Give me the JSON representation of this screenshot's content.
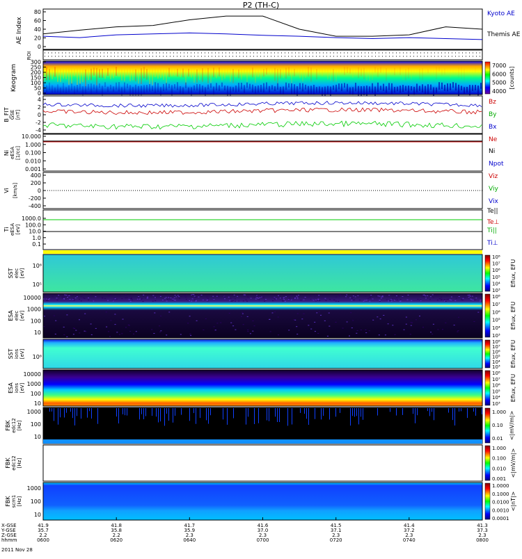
{
  "title": "P2 (TH-C)",
  "panels": {
    "ae": {
      "ylabel": "AE Index",
      "yticks": [
        "80",
        "60",
        "40",
        "20",
        "0"
      ],
      "legend": [
        {
          "text": "Kyoto AE",
          "color": "#0000cc"
        },
        {
          "text": "Themis AE",
          "color": "#000000"
        }
      ]
    },
    "roi": {
      "ylabel": "ROI"
    },
    "keo": {
      "ylabel": "Keogram",
      "yticks": [
        "300",
        "250",
        "200",
        "150",
        "100",
        "50",
        "0"
      ],
      "colorbar": [
        "7000",
        "6000",
        "5000",
        "4000"
      ],
      "colorbar_label": "[counts]"
    },
    "bfit": {
      "ylabel": "B_FIT",
      "ylabel2": "GSE",
      "ylabel3": "[nT]",
      "yticks": [
        "4",
        "2",
        "0",
        "-2",
        "-4"
      ],
      "legend": [
        {
          "text": "Bz",
          "color": "#cc0000"
        },
        {
          "text": "By",
          "color": "#00aa00"
        },
        {
          "text": "Bx",
          "color": "#0000cc"
        }
      ]
    },
    "ni": {
      "ylabel": "Ni",
      "ylabel2": "eESA",
      "ylabel3": "[1/cc]",
      "yticks": [
        "10.000",
        "1.000",
        "0.100",
        "0.010",
        "0.001"
      ],
      "legend": [
        {
          "text": "Ne",
          "color": "#cc0000"
        },
        {
          "text": "Ni",
          "color": "#000000"
        },
        {
          "text": "Npot",
          "color": "#0000cc"
        }
      ]
    },
    "vi": {
      "ylabel": "Vi",
      "ylabel3": "[km/s]",
      "yticks": [
        "400",
        "200",
        "0",
        "-200",
        "-400"
      ],
      "legend": [
        {
          "text": "Viz",
          "color": "#cc0000"
        },
        {
          "text": "Viy",
          "color": "#00aa00"
        },
        {
          "text": "Vix",
          "color": "#0000cc"
        }
      ]
    },
    "ti": {
      "ylabel": "Ti",
      "ylabel2": "eESA",
      "ylabel3": "[eV]",
      "yticks": [
        "1000.0",
        "100.0",
        "10.0",
        "1.0",
        "0.1"
      ],
      "legend": [
        {
          "text": "Te||",
          "color": "#000000"
        },
        {
          "text": "Te⊥",
          "color": "#cc0000"
        },
        {
          "text": "Ti||",
          "color": "#00aa00"
        },
        {
          "text": "Ti⊥",
          "color": "#0000cc"
        }
      ]
    },
    "sste": {
      "ylabel": "SST",
      "ylabel2": "elec",
      "ylabel3": "[eV]",
      "yticks": [
        "10⁶",
        "10⁵"
      ],
      "cbticks": [
        "10⁸",
        "10⁷",
        "10⁶",
        "10⁵",
        "10⁴",
        "10³"
      ],
      "cblabel": "Eflux, EFU"
    },
    "esae": {
      "ylabel": "ESA",
      "ylabel2": "elec",
      "ylabel3": "[eV]",
      "yticks": [
        "10000",
        "1000",
        "100",
        "10"
      ],
      "cbticks": [
        "10⁸",
        "10⁷",
        "10⁶",
        "10⁵",
        "10⁴",
        "10³"
      ],
      "cblabel": "Eflux, EFU"
    },
    "ssti": {
      "ylabel": "SST",
      "ylabel2": "ions",
      "ylabel3": "[eV]",
      "yticks": [
        "10⁶"
      ],
      "cbticks": [
        "10⁸",
        "10⁷",
        "10⁶",
        "10⁵",
        "10⁴",
        "10³"
      ],
      "cblabel": "Eflux, EFU"
    },
    "esai": {
      "ylabel": "ESA",
      "ylabel2": "ions",
      "ylabel3": "[eV]",
      "yticks": [
        "10000",
        "1000",
        "100",
        "10"
      ],
      "cbticks": [
        "10⁸",
        "10⁷",
        "10⁶",
        "10⁵",
        "10⁴",
        "10³"
      ],
      "cblabel": "Eflux, EFU"
    },
    "fbk1": {
      "ylabel": "FBK",
      "ylabel2": "edc12",
      "ylabel3": "[Hz]",
      "yticks": [
        "1000",
        "100",
        "10"
      ],
      "cbticks": [
        "1.000",
        "0.10",
        "0.01"
      ],
      "cblabel": "<|mV/m|>"
    },
    "fbk2": {
      "ylabel": "FBK",
      "ylabel2": "edc12",
      "ylabel3": "[Hz]",
      "cbticks": [
        "1.000",
        "0.100",
        "0.010",
        "0.001"
      ],
      "cblabel": "<|mV/m|>"
    },
    "fbk3": {
      "ylabel": "FBK",
      "ylabel2": "scm1",
      "ylabel3": "[Hz]",
      "yticks": [
        "1000",
        "100",
        "10"
      ],
      "cbticks": [
        "1.0000",
        "0.1000",
        "0.0100",
        "0.0010",
        "0.0001"
      ],
      "cblabel": "<|nT|>"
    }
  },
  "xaxis": {
    "row_labels": [
      "X-GSE",
      "Y-GSE",
      "Z-GSE",
      "hhmm",
      "2011 Nov 28"
    ],
    "columns": [
      {
        "x": "41.9",
        "y": "35.7",
        "z": "2.2",
        "t": "0600"
      },
      {
        "x": "41.8",
        "y": "35.8",
        "z": "2.2",
        "t": "0620"
      },
      {
        "x": "41.7",
        "y": "35.9",
        "z": "2.3",
        "t": "0640"
      },
      {
        "x": "41.6",
        "y": "37.0",
        "z": "2.3",
        "t": "0700"
      },
      {
        "x": "41.5",
        "y": "37.1",
        "z": "2.3",
        "t": "0720"
      },
      {
        "x": "41.4",
        "y": "37.2",
        "z": "2.3",
        "t": "0740"
      },
      {
        "x": "41.3",
        "y": "37.3",
        "z": "2.3",
        "t": "0800"
      }
    ]
  },
  "chart_data": {
    "type": "line",
    "x_unit": "UT minutes after 06:00",
    "x": [
      0,
      10,
      20,
      30,
      40,
      50,
      60,
      70,
      80,
      90,
      100,
      110,
      120
    ],
    "series": [
      {
        "name": "Kyoto AE",
        "values": [
          25,
          22,
          28,
          30,
          32,
          30,
          27,
          25,
          22,
          20,
          22,
          20,
          18
        ],
        "color": "#0000cc"
      },
      {
        "name": "Themis AE",
        "values": [
          30,
          38,
          45,
          48,
          60,
          68,
          68,
          40,
          25,
          25,
          28,
          45,
          40
        ],
        "color": "#000000"
      }
    ],
    "ylim": [
      0,
      80
    ]
  }
}
